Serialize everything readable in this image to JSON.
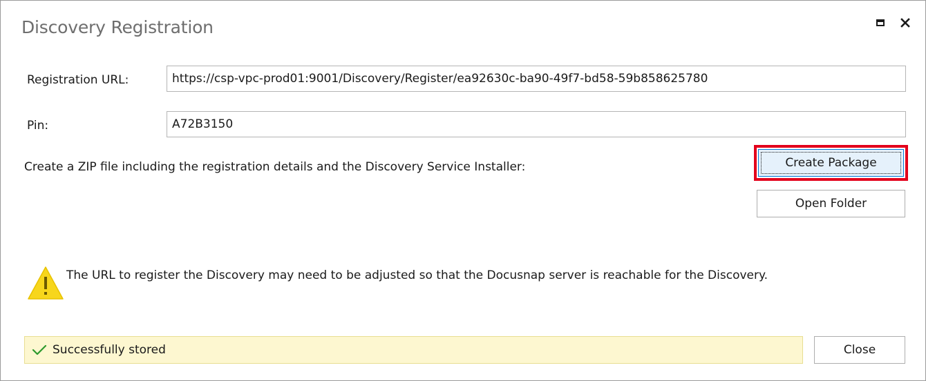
{
  "window": {
    "title": "Discovery Registration",
    "maximize_icon": "maximize-icon",
    "close_icon": "close-icon"
  },
  "form": {
    "registration_url_label": "Registration URL:",
    "registration_url_value": "https://csp-vpc-prod01:9001/Discovery/Register/ea92630c-ba90-49f7-bd58-59b858625780",
    "pin_label": "Pin:",
    "pin_value": "A72B3150"
  },
  "package": {
    "description": "Create a ZIP file including the registration details and the Discovery Service Installer:",
    "create_button_label": "Create Package",
    "open_folder_button_label": "Open Folder"
  },
  "warning": {
    "icon": "warning-icon",
    "text": "The URL to register the Discovery may need to be adjusted so that the Docusnap server is reachable for the Discovery."
  },
  "status": {
    "icon": "checkmark-icon",
    "text": "Successfully stored",
    "background_color": "#fdf7d0",
    "check_color": "#2e9a2e"
  },
  "footer": {
    "close_button_label": "Close"
  },
  "colors": {
    "highlight": "#e3001b",
    "focused_button_bg": "#e5f1fb",
    "warning_yellow": "#f7d61c"
  }
}
